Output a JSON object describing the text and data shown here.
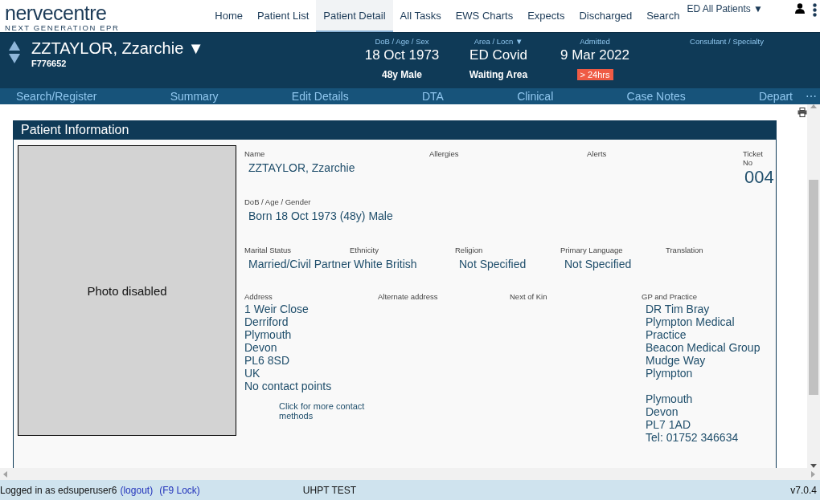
{
  "app": {
    "logo": "nervecentre",
    "tagline": "NEXT GENERATION EPR"
  },
  "top_nav": [
    {
      "label": "Home",
      "selected": false
    },
    {
      "label": "Patient List",
      "selected": false
    },
    {
      "label": "Patient Detail",
      "selected": true
    },
    {
      "label": "All Tasks",
      "selected": false
    },
    {
      "label": "EWS Charts",
      "selected": false
    },
    {
      "label": "Expects",
      "selected": false
    },
    {
      "label": "Discharged",
      "selected": false
    },
    {
      "label": "Search",
      "selected": false
    }
  ],
  "ward_selector": {
    "label": "ED All Patients",
    "caret": "▼"
  },
  "patient_header": {
    "name": "ZZTAYLOR, Zzarchie",
    "caret": "▼",
    "id": "F776652",
    "fields": [
      {
        "label": "DoB / Age / Sex",
        "value": "18 Oct 1973",
        "detail": "48y Male"
      },
      {
        "label": "Area / Locn",
        "caret": "▼",
        "value": "ED Covid",
        "detail": "Waiting Area"
      },
      {
        "label": "Admitted",
        "value": "9 Mar 2022",
        "badge": "> 24hrs"
      },
      {
        "label": "Consultant / Specialty"
      }
    ]
  },
  "action_bar": {
    "items": [
      "Search/Register",
      "Summary",
      "Edit Details",
      "DTA",
      "Clinical",
      "Case Notes",
      "Depart"
    ],
    "more": "⋯"
  },
  "panel": {
    "title": "Patient Information",
    "photo": "Photo disabled",
    "name": {
      "label": "Name",
      "value": "ZZTAYLOR, Zzarchie"
    },
    "allergies": {
      "label": "Allergies"
    },
    "alerts": {
      "label": "Alerts"
    },
    "ticket": {
      "label": "Ticket No",
      "value": "004"
    },
    "dob": {
      "label": "DoB / Age / Gender",
      "value": "Born 18 Oct 1973 (48y) Male"
    },
    "demographics": [
      {
        "label": "Marital Status",
        "value": "Married/Civil Partner"
      },
      {
        "label": "Ethnicity",
        "value": "White British"
      },
      {
        "label": "Religion",
        "value": "Not Specified"
      },
      {
        "label": "Primary Language",
        "value": "Not Specified"
      },
      {
        "label": "Translation"
      }
    ],
    "address": {
      "label": "Address",
      "lines": [
        "1 Weir Close",
        "Derriford",
        "Plymouth",
        "Devon",
        "PL6 8SD",
        "UK",
        "No contact points"
      ],
      "link": "Click for more contact methods"
    },
    "alternate_address": {
      "label": "Alternate address"
    },
    "next_of_kin": {
      "label": "Next of Kin"
    },
    "gp": {
      "label": "GP and Practice",
      "blocks": [
        [
          "DR Tim Bray",
          "Plympton Medical Practice",
          "Beacon Medical Group",
          "Mudge Way",
          "Plympton"
        ],
        [
          "Plymouth",
          "Devon",
          "PL7 1AD",
          "Tel: 01752 346634"
        ]
      ]
    }
  },
  "status_bar": {
    "user": "Logged in as edsuperuser6",
    "logout": "(logout)",
    "lock": "(F9 Lock)",
    "environment": "UHPT TEST",
    "version": "v7.0.4"
  }
}
